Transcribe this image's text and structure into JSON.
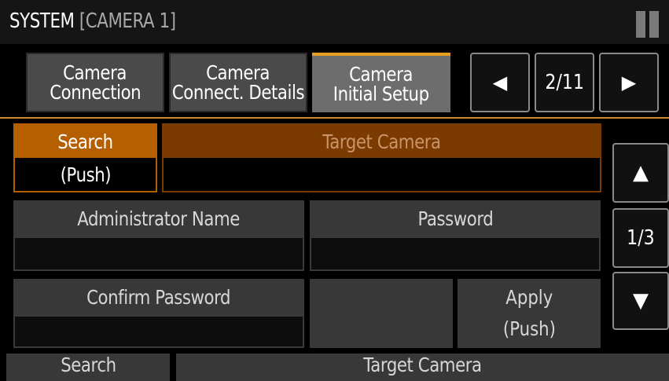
{
  "window": {
    "title": "SYSTEM",
    "subtitle": "[CAMERA 1]"
  },
  "tabs": [
    {
      "line1": "Camera",
      "line2": "Connection",
      "active": false
    },
    {
      "line1": "Camera",
      "line2": "Connect. Details",
      "active": false
    },
    {
      "line1": "Camera",
      "line2": "Initial Setup",
      "active": true
    }
  ],
  "pager": {
    "prev_icon": "◀",
    "page": "2/11",
    "next_icon": "▶"
  },
  "form": {
    "search_label": "Search",
    "search_push": "(Push)",
    "target_camera_label": "Target Camera",
    "target_camera_value": "",
    "admin_name_label": "Administrator Name",
    "admin_name_value": "",
    "password_label": "Password",
    "password_value": "",
    "confirm_password_label": "Confirm Password",
    "confirm_password_value": "",
    "apply_label": "Apply",
    "apply_push": "(Push)"
  },
  "scroll": {
    "up_icon": "▲",
    "page": "1/3",
    "down_icon": "▼"
  },
  "footer": {
    "search_label": "Search",
    "target_camera_label": "Target Camera"
  },
  "colors": {
    "accent_orange": "#b65f00",
    "tab_active_line": "#e8a020",
    "target_header": "#7a3a00"
  }
}
